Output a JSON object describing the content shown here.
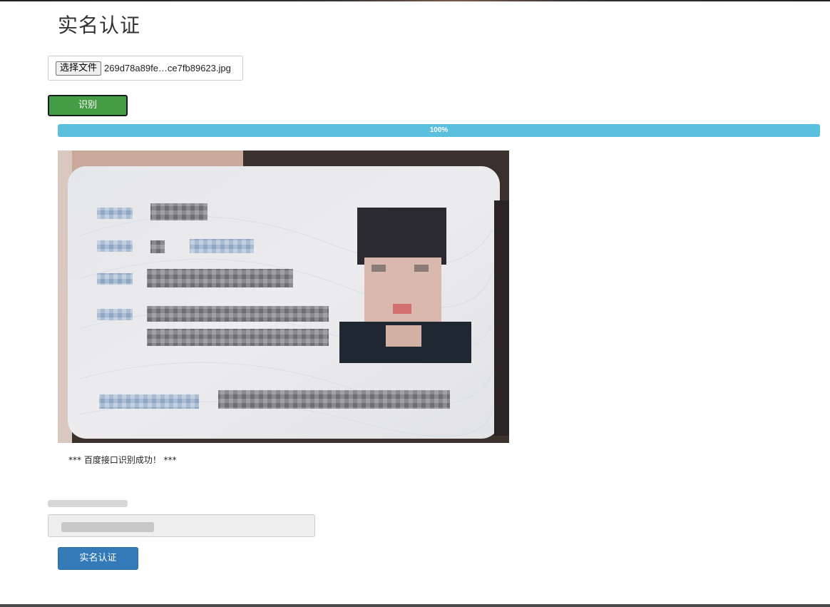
{
  "page": {
    "title": "实名认证"
  },
  "upload": {
    "choose_label": "选择文件",
    "file_name": "269d78a89fe…ce7fb89623.jpg"
  },
  "recognize": {
    "label": "识别"
  },
  "progress": {
    "text": "100%",
    "percent": 100,
    "color": "#5bc0de"
  },
  "result": {
    "status": "*** 百度接口识别成功！ ***"
  },
  "form": {
    "name_value": ""
  },
  "submit": {
    "label": "实名认证",
    "color": "#337ab7"
  },
  "icons": [
    "id-card-image"
  ]
}
